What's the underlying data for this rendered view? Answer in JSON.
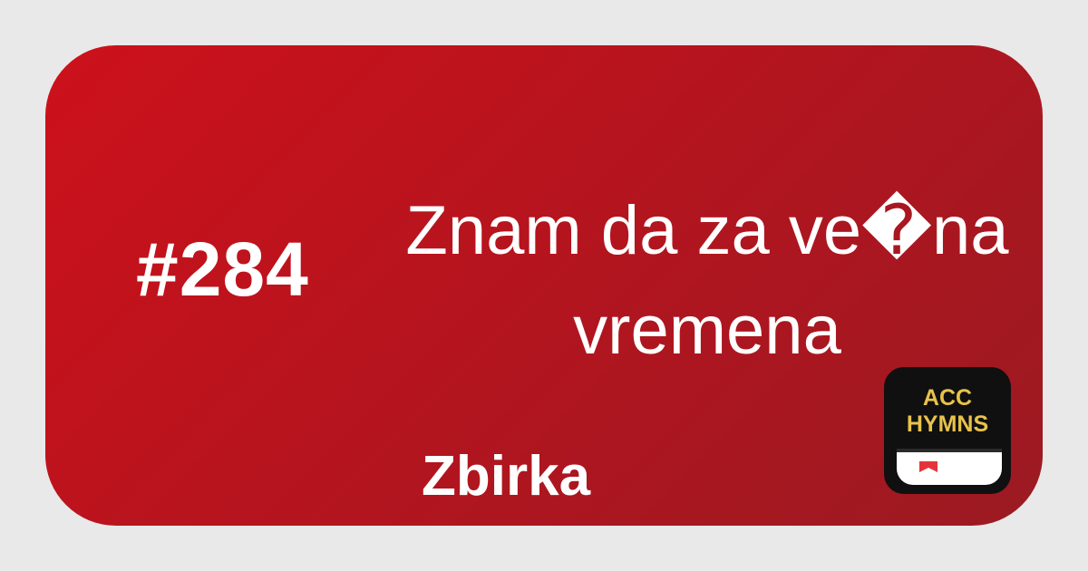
{
  "hymn": {
    "number": "#284",
    "title": "Znam da za ve�na vremena",
    "collection": "Zbirka"
  },
  "logo": {
    "text": "ACC HYMNS",
    "text_color": "#e8c24a",
    "bookmark_color": "#e5333a"
  },
  "colors": {
    "background": "#e9e9e9",
    "card_gradient_start": "#cd111b",
    "card_gradient_end": "#9b1a22",
    "text": "#ffffff"
  }
}
